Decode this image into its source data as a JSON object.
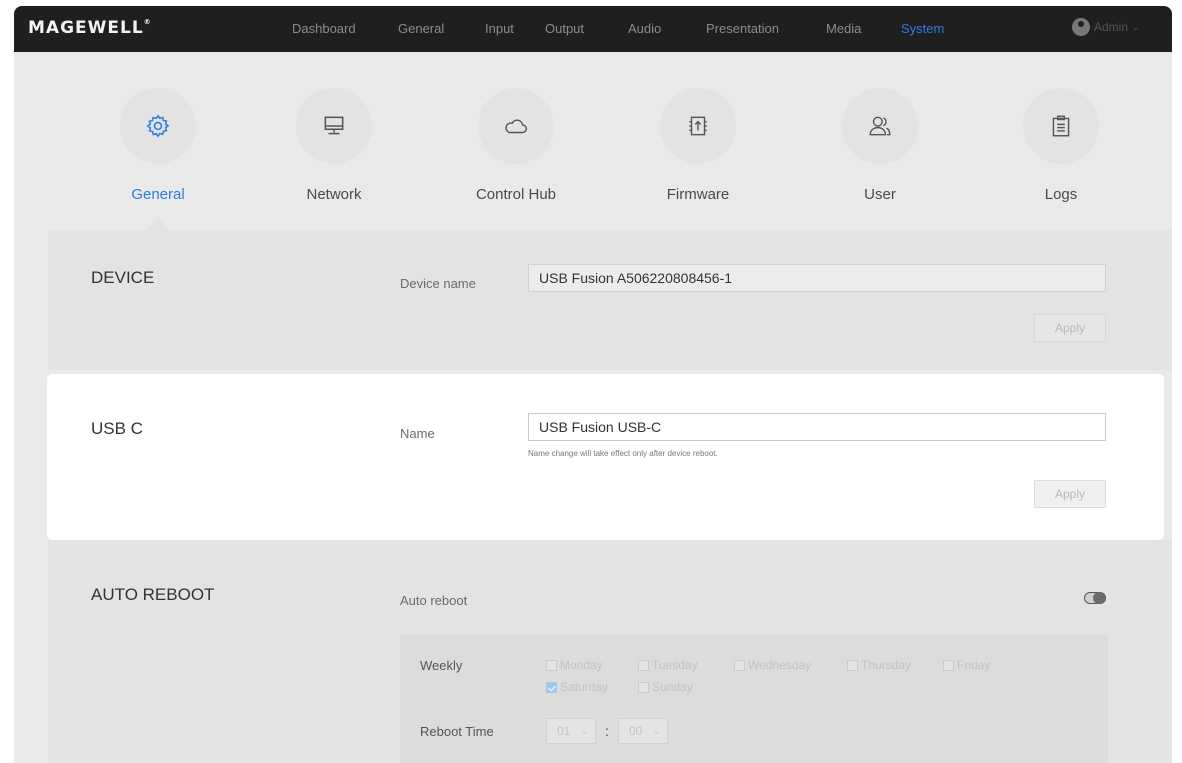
{
  "brand": {
    "logo_text": "MAGEWELL",
    "accent_color": "#2c7be5"
  },
  "nav": {
    "items": [
      {
        "label": "Dashboard",
        "active": false
      },
      {
        "label": "General",
        "active": false
      },
      {
        "label": "Input",
        "active": false
      },
      {
        "label": "Output",
        "active": false
      },
      {
        "label": "Audio",
        "active": false
      },
      {
        "label": "Presentation",
        "active": false
      },
      {
        "label": "Media",
        "active": false
      },
      {
        "label": "System",
        "active": true
      }
    ],
    "user": "Admin"
  },
  "categories": [
    {
      "label": "General",
      "icon": "gear-icon",
      "active": true
    },
    {
      "label": "Network",
      "icon": "monitor-icon",
      "active": false
    },
    {
      "label": "Control Hub",
      "icon": "cloud-icon",
      "active": false
    },
    {
      "label": "Firmware",
      "icon": "firmware-upload-icon",
      "active": false
    },
    {
      "label": "User",
      "icon": "users-icon",
      "active": false
    },
    {
      "label": "Logs",
      "icon": "clipboard-icon",
      "active": false
    }
  ],
  "device": {
    "title": "DEVICE",
    "field_label": "Device name",
    "value": "USB Fusion A506220808456-1",
    "apply_label": "Apply"
  },
  "usbc": {
    "title": "USB C",
    "field_label": "Name",
    "value": "USB Fusion USB-C",
    "hint": "Name change will take effect only after device reboot.",
    "apply_label": "Apply"
  },
  "auto_reboot": {
    "title": "AUTO REBOOT",
    "toggle_label": "Auto reboot",
    "enabled": true,
    "weekly_label": "Weekly",
    "days": [
      {
        "label": "Monday",
        "checked": false
      },
      {
        "label": "Tuesday",
        "checked": false
      },
      {
        "label": "Wednesday",
        "checked": false
      },
      {
        "label": "Thursday",
        "checked": false
      },
      {
        "label": "Friday",
        "checked": false
      },
      {
        "label": "Saturday",
        "checked": true
      },
      {
        "label": "Sunday",
        "checked": false
      }
    ],
    "time_label": "Reboot Time",
    "hour": "01",
    "separator": ":",
    "minute": "00"
  }
}
